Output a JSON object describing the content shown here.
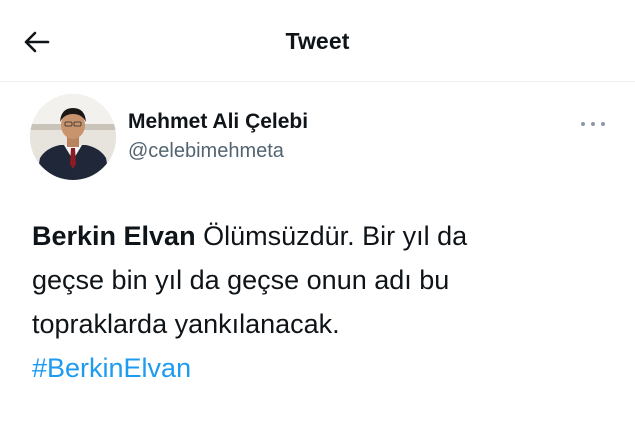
{
  "header": {
    "back_icon": "arrow-left-icon",
    "title": "Tweet"
  },
  "author": {
    "name": "Mehmet Ali Çelebi",
    "handle": "@celebimehmeta",
    "avatar_icon": "profile-photo",
    "more_icon": "more-dots-icon"
  },
  "tweet": {
    "mention_name": "Berkin Elvan",
    "line1_rest": " Ölümsüzdür. Bir yıl da",
    "line2": "geçse bin yıl da geçse onun adı bu",
    "line3": "topraklarda yankılanacak.",
    "hashtag": "#BerkinElvan"
  },
  "colors": {
    "text": "#0f1419",
    "secondary": "#536471",
    "link": "#1d9bf0"
  }
}
